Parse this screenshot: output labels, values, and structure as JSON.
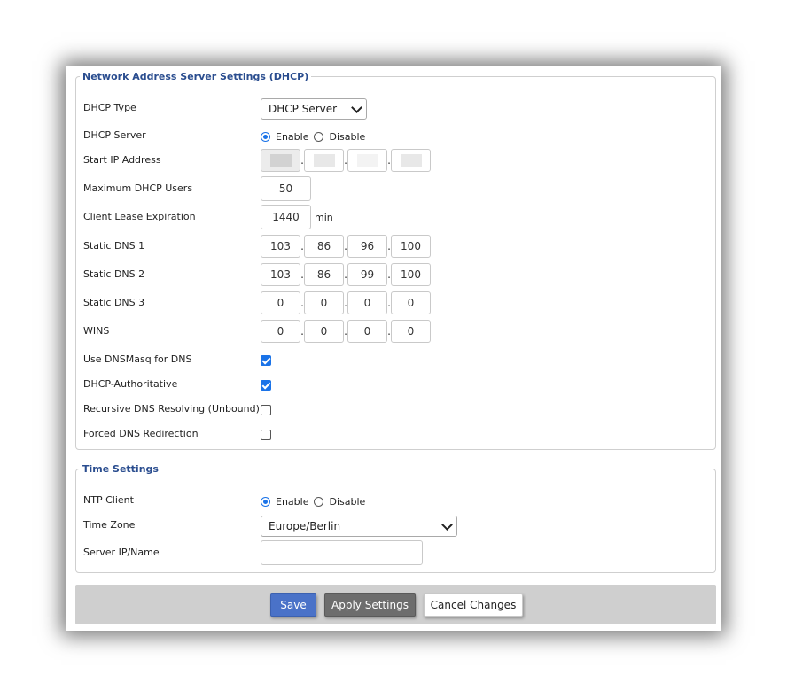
{
  "dhcp": {
    "legend": "Network Address Server Settings (DHCP)",
    "type": {
      "label": "DHCP Type",
      "value": "DHCP Server"
    },
    "server": {
      "label": "DHCP Server",
      "enable": "Enable",
      "disable": "Disable",
      "selected": "Enable"
    },
    "start_ip": {
      "label": "Start IP Address",
      "octets": [
        "",
        "",
        "",
        ""
      ],
      "masked": true
    },
    "max_users": {
      "label": "Maximum DHCP Users",
      "value": "50"
    },
    "lease": {
      "label": "Client Lease Expiration",
      "value": "1440",
      "unit": "min"
    },
    "dns1": {
      "label": "Static DNS 1",
      "octets": [
        "103",
        "86",
        "96",
        "100"
      ]
    },
    "dns2": {
      "label": "Static DNS 2",
      "octets": [
        "103",
        "86",
        "99",
        "100"
      ]
    },
    "dns3": {
      "label": "Static DNS 3",
      "octets": [
        "0",
        "0",
        "0",
        "0"
      ]
    },
    "wins": {
      "label": "WINS",
      "octets": [
        "0",
        "0",
        "0",
        "0"
      ]
    },
    "dnsmasq": {
      "label": "Use DNSMasq for DNS",
      "checked": true
    },
    "authoritative": {
      "label": "DHCP-Authoritative",
      "checked": true
    },
    "recursive": {
      "label": "Recursive DNS Resolving (Unbound)",
      "checked": false
    },
    "forced": {
      "label": "Forced DNS Redirection",
      "checked": false
    }
  },
  "time": {
    "legend": "Time Settings",
    "ntp": {
      "label": "NTP Client",
      "enable": "Enable",
      "disable": "Disable",
      "selected": "Enable"
    },
    "zone": {
      "label": "Time Zone",
      "value": "Europe/Berlin"
    },
    "server": {
      "label": "Server IP/Name",
      "value": ""
    }
  },
  "actions": {
    "save": "Save",
    "apply": "Apply Settings",
    "cancel": "Cancel Changes"
  },
  "colors": {
    "legend": "#2a4d8f",
    "save_bg": "#4a72c8",
    "apply_bg": "#6d6d6d",
    "bar_bg": "#cfcfcf",
    "accent": "#1a73e8"
  },
  "icons": [
    "chevron-down-icon",
    "radio-icon",
    "checkbox-icon"
  ]
}
